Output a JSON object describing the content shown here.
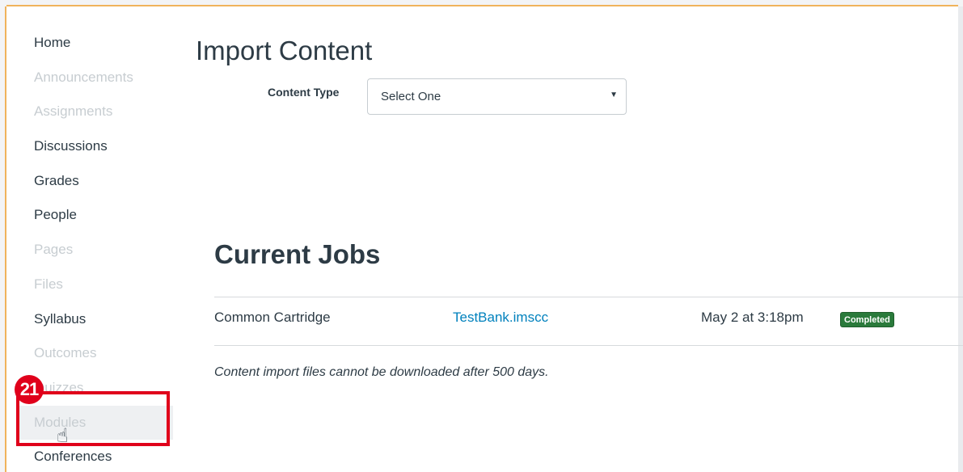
{
  "sidebar": {
    "items": [
      {
        "label": "Home",
        "enabled": true
      },
      {
        "label": "Announcements",
        "enabled": false
      },
      {
        "label": "Assignments",
        "enabled": false
      },
      {
        "label": "Discussions",
        "enabled": true
      },
      {
        "label": "Grades",
        "enabled": true
      },
      {
        "label": "People",
        "enabled": true
      },
      {
        "label": "Pages",
        "enabled": false
      },
      {
        "label": "Files",
        "enabled": false
      },
      {
        "label": "Syllabus",
        "enabled": true
      },
      {
        "label": "Outcomes",
        "enabled": false
      },
      {
        "label": "Quizzes",
        "enabled": false
      },
      {
        "label": "Modules",
        "enabled": false
      },
      {
        "label": "Conferences",
        "enabled": true
      }
    ]
  },
  "main": {
    "title": "Import Content",
    "content_type_label": "Content Type",
    "content_type_value": "Select One",
    "jobs": {
      "title": "Current Jobs",
      "rows": [
        {
          "type": "Common Cartridge",
          "file": "TestBank.imscc",
          "date": "May 2 at 3:18pm",
          "status": "Completed"
        }
      ],
      "note": "Content import files cannot be downloaded after 500 days."
    }
  },
  "annotation": {
    "step": "21"
  },
  "colors": {
    "link": "#0081bd",
    "completed_badge": "#2a7a3b",
    "highlight": "#e0001b",
    "frame_accent": "#f0b35c"
  },
  "icons": {
    "select_arrow": "caret-down-icon",
    "cursor": "hand-pointer-icon"
  }
}
